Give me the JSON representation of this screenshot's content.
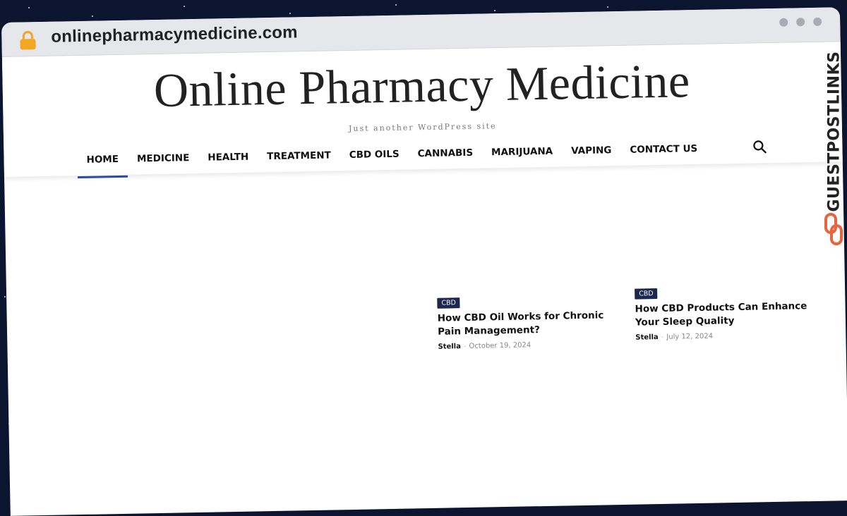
{
  "browser": {
    "url": "onlinepharmacymedicine.com",
    "lock_icon": "lock-icon",
    "window_controls": [
      "dot",
      "dot",
      "dot"
    ]
  },
  "site": {
    "title": "Online Pharmacy Medicine",
    "tagline": "Just another WordPress site"
  },
  "nav": {
    "items": [
      {
        "label": "HOME",
        "active": true
      },
      {
        "label": "MEDICINE"
      },
      {
        "label": "HEALTH"
      },
      {
        "label": "TREATMENT"
      },
      {
        "label": "CBD OILS"
      },
      {
        "label": "CANNABIS"
      },
      {
        "label": "MARIJUANA"
      },
      {
        "label": "VAPING"
      },
      {
        "label": "CONTACT US"
      }
    ],
    "search_icon": "search-icon",
    "active_color": "#2c4aa8"
  },
  "posts": [
    {
      "category": "CBD",
      "title": "How CBD Oil Works for Chronic Pain Management?",
      "author": "Stella",
      "separator": "-",
      "date": "October 19, 2024"
    },
    {
      "category": "CBD",
      "title": "How CBD Products Can Enhance Your Sleep Quality",
      "author": "Stella",
      "separator": "-",
      "date": "July 12, 2024"
    }
  ],
  "watermark": {
    "text": "GUESTPOSTLINKS",
    "icon": "link-icon",
    "accent": "#e8643c"
  },
  "colors": {
    "badge": "#1b2750",
    "background": "#0b1530"
  }
}
